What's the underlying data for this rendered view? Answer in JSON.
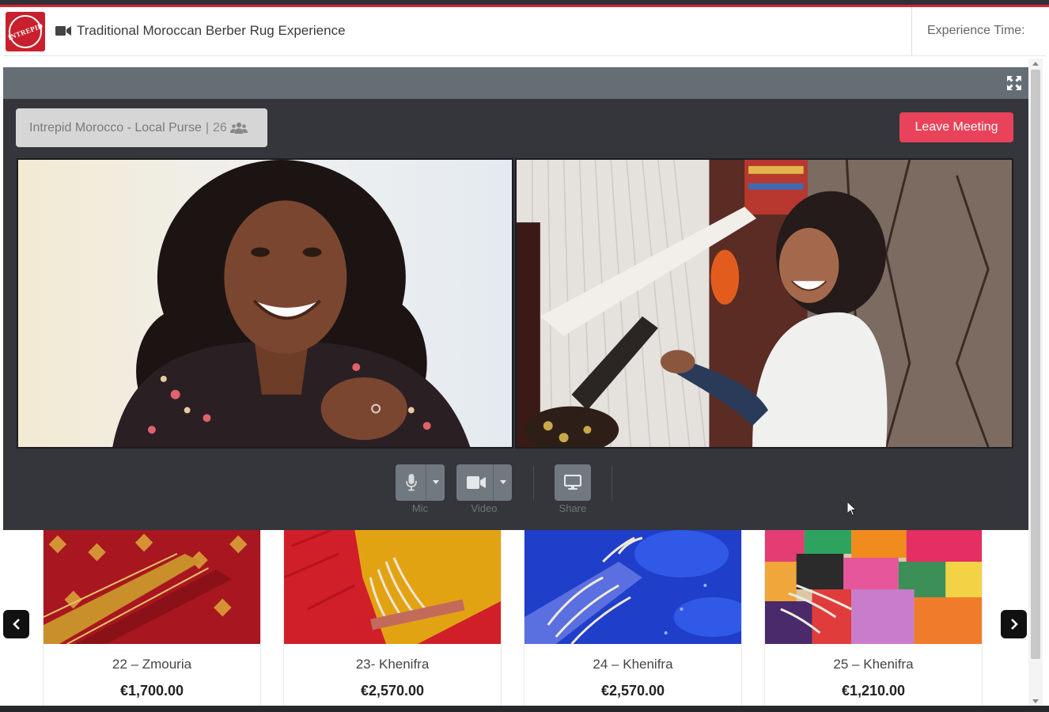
{
  "header": {
    "logo_text": "INTREPID",
    "title": "Traditional Moroccan Berber Rug Experience",
    "experience_time_label": "Experience Time:"
  },
  "meeting": {
    "room_name": "Intrepid Morocco - Local Purse",
    "separator": "|",
    "participant_count": "26",
    "leave_label": "Leave Meeting",
    "controls": {
      "mic_label": "Mic",
      "video_label": "Video",
      "share_label": "Share"
    }
  },
  "products": [
    {
      "name": "22 – Zmouria",
      "price": "€1,700.00"
    },
    {
      "name": "23- Khenifra",
      "price": "€2,570.00"
    },
    {
      "name": "24 – Khenifra",
      "price": "€2,570.00"
    },
    {
      "name": "25 – Khenifra",
      "price": "€1,210.00"
    }
  ],
  "colors": {
    "brand_red": "#c8202c",
    "leave_button": "#e8435a",
    "meeting_bg": "#34363b",
    "meeting_bar": "#656d75"
  }
}
